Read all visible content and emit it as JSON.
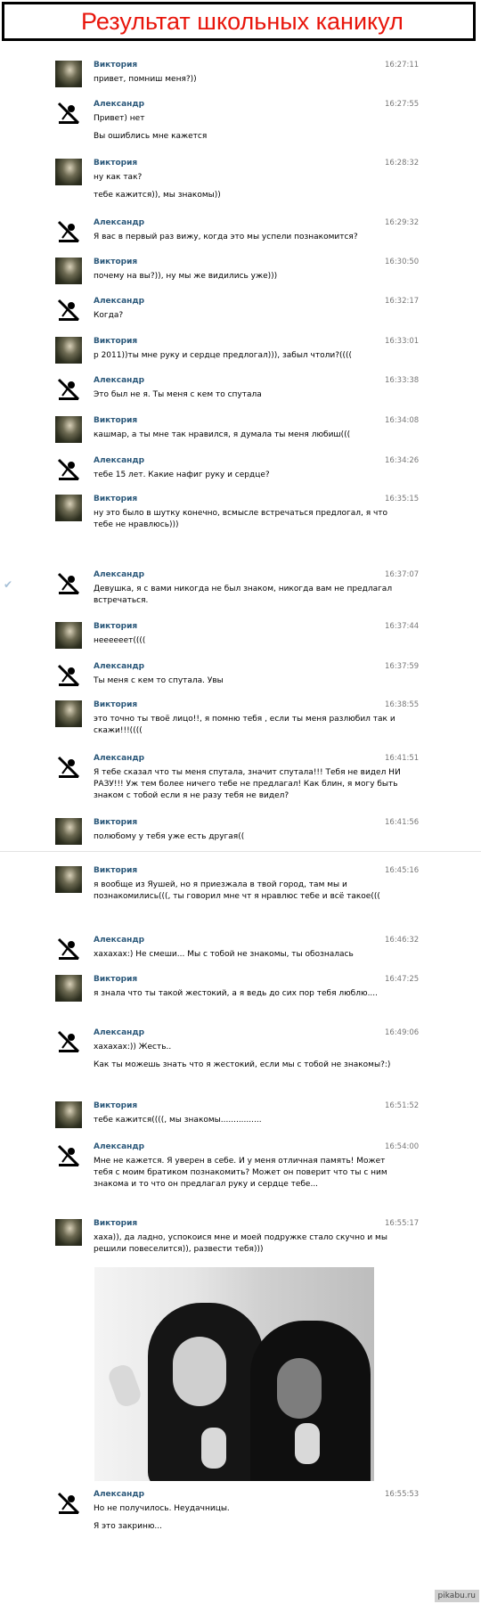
{
  "title": "Результат школьных каникул",
  "watermark": "pikabu.ru",
  "colors": {
    "title": "#e8160c",
    "name": "#2b587a",
    "time": "#777777"
  },
  "messages": [
    {
      "author": "Виктория",
      "avatar": "victoria",
      "time": "16:27:11",
      "lines": [
        "привет, помниш меня?))"
      ]
    },
    {
      "author": "Александр",
      "avatar": "alexander",
      "time": "16:27:55",
      "lines": [
        "Привет) нет",
        "Вы ошиблись мне кажется"
      ]
    },
    {
      "author": "Виктория",
      "avatar": "victoria",
      "time": "16:28:32",
      "lines": [
        "ну как так?",
        "тебе кажится)), мы знакомы))"
      ]
    },
    {
      "author": "Александр",
      "avatar": "alexander",
      "time": "16:29:32",
      "lines": [
        "Я вас в первый раз вижу, когда это мы успели познакомится?"
      ]
    },
    {
      "author": "Виктория",
      "avatar": "victoria",
      "time": "16:30:50",
      "lines": [
        "почему на вы?)), ну мы же видились уже)))"
      ]
    },
    {
      "author": "Александр",
      "avatar": "alexander",
      "time": "16:32:17",
      "lines": [
        "Когда?"
      ]
    },
    {
      "author": "Виктория",
      "avatar": "victoria",
      "time": "16:33:01",
      "lines": [
        "р 2011))ты мне руку и сердце предлогал))), забыл чтоли?(((("
      ]
    },
    {
      "author": "Александр",
      "avatar": "alexander",
      "time": "16:33:38",
      "lines": [
        "Это был не я. Ты меня с кем то спутала"
      ]
    },
    {
      "author": "Виктория",
      "avatar": "victoria",
      "time": "16:34:08",
      "lines": [
        "кашмар, а ты мне так нравился, я думала ты меня любиш((("
      ]
    },
    {
      "author": "Александр",
      "avatar": "alexander",
      "time": "16:34:26",
      "lines": [
        "тебе 15 лет. Какие нафиг руку и сердце?"
      ]
    },
    {
      "author": "Виктория",
      "avatar": "victoria",
      "time": "16:35:15",
      "lines": [
        "ну это было в шутку конечно, всмысле встречаться предлогал, я что тебе не нравлюсь)))"
      ]
    },
    {
      "author": "Александр",
      "avatar": "alexander",
      "time": "16:37:07",
      "lines": [
        "Девушка, я с вами никогда не был знаком, никогда вам не предлагал встречаться."
      ]
    },
    {
      "author": "Виктория",
      "avatar": "victoria",
      "time": "16:37:44",
      "lines": [
        "неееееет(((("
      ]
    },
    {
      "author": "Александр",
      "avatar": "alexander",
      "time": "16:37:59",
      "lines": [
        "Ты меня с кем то спутала. Увы"
      ]
    },
    {
      "author": "Виктория",
      "avatar": "victoria",
      "time": "16:38:55",
      "lines": [
        "это точно ты твоё лицо!!, я помню тебя , если ты меня разлюбил так и скажи!!!(((("
      ]
    },
    {
      "author": "Александр",
      "avatar": "alexander",
      "time": "16:41:51",
      "lines": [
        "Я тебе сказал что ты меня спутала, значит спутала!!! Тебя не видел НИ РАЗУ!!! Уж тем более ничего тебе не предлагал! Как блин, я могу быть знаком с тобой если я не разу тебя не видел?"
      ]
    },
    {
      "author": "Виктория",
      "avatar": "victoria",
      "time": "16:41:56",
      "lines": [
        "полюбому у тебя уже есть другая(("
      ]
    },
    {
      "author": "Виктория",
      "avatar": "victoria",
      "time": "16:45:16",
      "lines": [
        "я вообще из Яушей, но я приезжала в твой город, там мы и познакомились(((, ты говорил мне чт я нравлюс тебе и всё такое((("
      ]
    },
    {
      "author": "Александр",
      "avatar": "alexander",
      "time": "16:46:32",
      "lines": [
        "хахахах:) Не смеши... Мы с тобой не знакомы, ты обозналась"
      ]
    },
    {
      "author": "Виктория",
      "avatar": "victoria",
      "time": "16:47:25",
      "lines": [
        "я знала что ты такой жестокий, а я ведь до сих пор тебя люблю...."
      ]
    },
    {
      "author": "Александр",
      "avatar": "alexander",
      "time": "16:49:06",
      "lines": [
        "хахахах:)) Жесть..",
        "Как ты можешь знать что я жестокий, если мы с тобой не знакомы?:)"
      ]
    },
    {
      "author": "Виктория",
      "avatar": "victoria",
      "time": "16:51:52",
      "lines": [
        "тебе кажится((((, мы знакомы................"
      ]
    },
    {
      "author": "Александр",
      "avatar": "alexander",
      "time": "16:54:00",
      "lines": [
        "Мне не кажется. Я уверен в себе. И у меня отличная память! Может тебя с моим братиком познакомить? Может он поверит что ты с ним знакома и то что он предлагал руку и сердце тебе..."
      ]
    },
    {
      "author": "Виктория",
      "avatar": "victoria",
      "time": "16:55:17",
      "lines": [
        "хаха)), да ладно, успокоися мне и моей подружке стало скучно и мы решили повеселится)), развести тебя)))"
      ]
    },
    {
      "author": "Александр",
      "avatar": "alexander",
      "time": "16:55:53",
      "lines": [
        "Но не получилось. Неудачницы.",
        "Я это закриню..."
      ]
    }
  ]
}
